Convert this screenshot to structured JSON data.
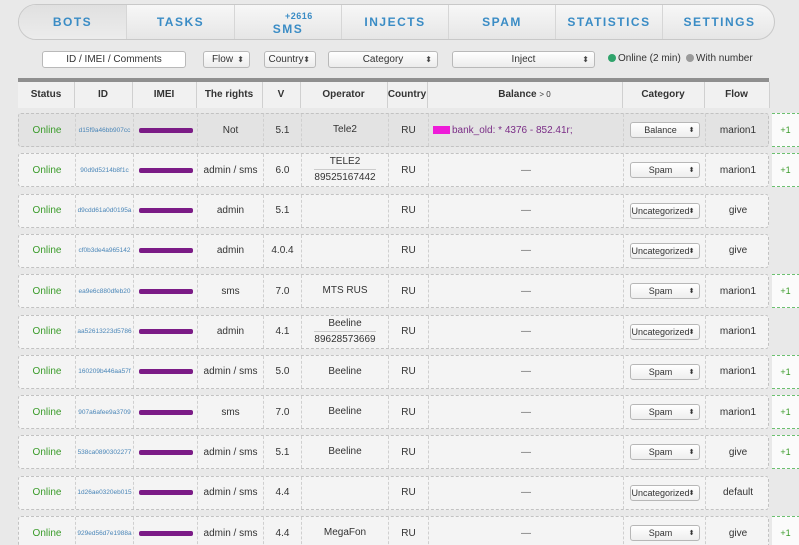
{
  "nav": {
    "tabs": [
      {
        "label": "BOTS",
        "active": true,
        "sup": ""
      },
      {
        "label": "TASKS",
        "active": false,
        "sup": ""
      },
      {
        "label": "SMS",
        "active": false,
        "sup": "+2616"
      },
      {
        "label": "INJECTS",
        "active": false,
        "sup": ""
      },
      {
        "label": "SPAM",
        "active": false,
        "sup": ""
      },
      {
        "label": "STATISTICS",
        "active": false,
        "sup": ""
      },
      {
        "label": "SETTINGS",
        "active": false,
        "sup": ""
      }
    ]
  },
  "filters": {
    "search_placeholder": "ID / IMEI / Comments",
    "flow": "Flow",
    "country": "Country",
    "category": "Category",
    "inject": "Inject",
    "online_label": "Online (2 min)",
    "with_number_label": "With number",
    "online_color": "#2fa36b",
    "with_number_color": "#9a9a9a"
  },
  "table": {
    "headers": {
      "status": "Status",
      "id": "ID",
      "imei": "IMEI",
      "rights": "The rights",
      "v": "V",
      "operator": "Operator",
      "country": "Country",
      "balance": "Balance",
      "balance_suffix": "> 0",
      "category": "Category",
      "flow": "Flow"
    },
    "rows": [
      {
        "status": "Online",
        "id": "d15f9a46bb907cc",
        "rights": "Not",
        "v": "5.1",
        "operator": "Tele2",
        "operator_number": "",
        "country": "RU",
        "balance": "bank_old: * 4376 - 852.41r;",
        "category": "Balance",
        "flow": "marion1",
        "plus": "+1",
        "highlight": true
      },
      {
        "status": "Online",
        "id": "90d9d5214b8f1c",
        "rights": "admin / sms",
        "v": "6.0",
        "operator": "TELE2",
        "operator_number": "89525167442",
        "country": "RU",
        "balance": "—",
        "category": "Spam",
        "flow": "marion1",
        "plus": "+1",
        "highlight": false
      },
      {
        "status": "Online",
        "id": "d9cdd61a0d0195a",
        "rights": "admin",
        "v": "5.1",
        "operator": "",
        "operator_number": "",
        "country": "RU",
        "balance": "—",
        "category": "Uncategorized",
        "flow": "give",
        "plus": "",
        "highlight": false
      },
      {
        "status": "Online",
        "id": "cf0b3de4a965142",
        "rights": "admin",
        "v": "4.0.4",
        "operator": "",
        "operator_number": "",
        "country": "RU",
        "balance": "—",
        "category": "Uncategorized",
        "flow": "give",
        "plus": "",
        "highlight": false
      },
      {
        "status": "Online",
        "id": "ea9e6c880dfeb20",
        "rights": "sms",
        "v": "7.0",
        "operator": "MTS RUS",
        "operator_number": "",
        "country": "RU",
        "balance": "—",
        "category": "Spam",
        "flow": "marion1",
        "plus": "+1",
        "highlight": false
      },
      {
        "status": "Online",
        "id": "aa52613223d5786",
        "rights": "admin",
        "v": "4.1",
        "operator": "Beeline",
        "operator_number": "89628573669",
        "country": "RU",
        "balance": "—",
        "category": "Uncategorized",
        "flow": "marion1",
        "plus": "",
        "highlight": false
      },
      {
        "status": "Online",
        "id": "160209b446aa57f",
        "rights": "admin / sms",
        "v": "5.0",
        "operator": "Beeline",
        "operator_number": "",
        "country": "RU",
        "balance": "—",
        "category": "Spam",
        "flow": "marion1",
        "plus": "+1",
        "highlight": false
      },
      {
        "status": "Online",
        "id": "907a6afee9a3709",
        "rights": "sms",
        "v": "7.0",
        "operator": "Beeline",
        "operator_number": "",
        "country": "RU",
        "balance": "—",
        "category": "Spam",
        "flow": "marion1",
        "plus": "+1",
        "highlight": false
      },
      {
        "status": "Online",
        "id": "538ca0890302277",
        "rights": "admin / sms",
        "v": "5.1",
        "operator": "Beeline",
        "operator_number": "",
        "country": "RU",
        "balance": "—",
        "category": "Spam",
        "flow": "give",
        "plus": "+1",
        "highlight": false
      },
      {
        "status": "Online",
        "id": "1d26ae0320eb015",
        "rights": "admin / sms",
        "v": "4.4",
        "operator": "",
        "operator_number": "",
        "country": "RU",
        "balance": "—",
        "category": "Uncategorized",
        "flow": "default",
        "plus": "",
        "highlight": false
      },
      {
        "status": "Online",
        "id": "929ed56d7e1988a",
        "rights": "admin / sms",
        "v": "4.4",
        "operator": "MegaFon",
        "operator_number": "",
        "country": "RU",
        "balance": "—",
        "category": "Spam",
        "flow": "give",
        "plus": "+1",
        "highlight": false
      }
    ]
  }
}
